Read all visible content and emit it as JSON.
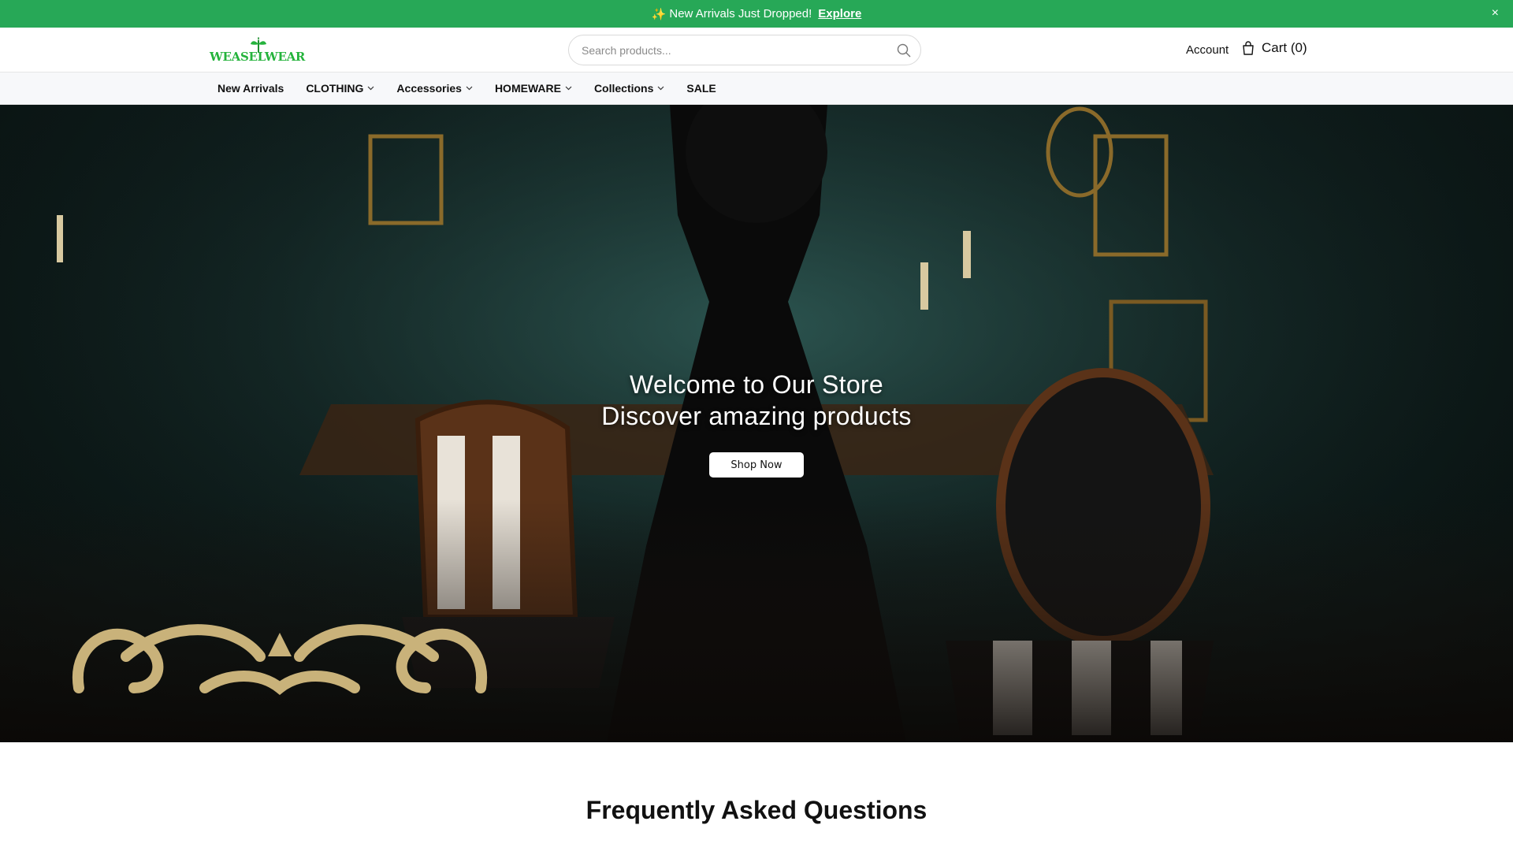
{
  "announcement": {
    "icon": "sparkles-icon",
    "text": "New Arrivals Just Dropped!",
    "link": "Explore",
    "close": "×",
    "bg_color": "#27a857"
  },
  "header": {
    "logo": "WEASELWEAR",
    "search_placeholder": "Search products...",
    "account": "Account",
    "cart": "Cart (0)"
  },
  "nav": {
    "items": [
      {
        "label": "New Arrivals",
        "dropdown": false
      },
      {
        "label": "CLOTHING",
        "dropdown": true
      },
      {
        "label": "Accessories",
        "dropdown": true
      },
      {
        "label": "HOMEWARE",
        "dropdown": true
      },
      {
        "label": "Collections",
        "dropdown": true
      },
      {
        "label": "SALE",
        "dropdown": false
      }
    ]
  },
  "hero": {
    "title": "Welcome to Our Store",
    "subtitle": "Discover amazing products",
    "button": "Shop Now"
  },
  "faq": {
    "title": "Frequently Asked Questions"
  }
}
